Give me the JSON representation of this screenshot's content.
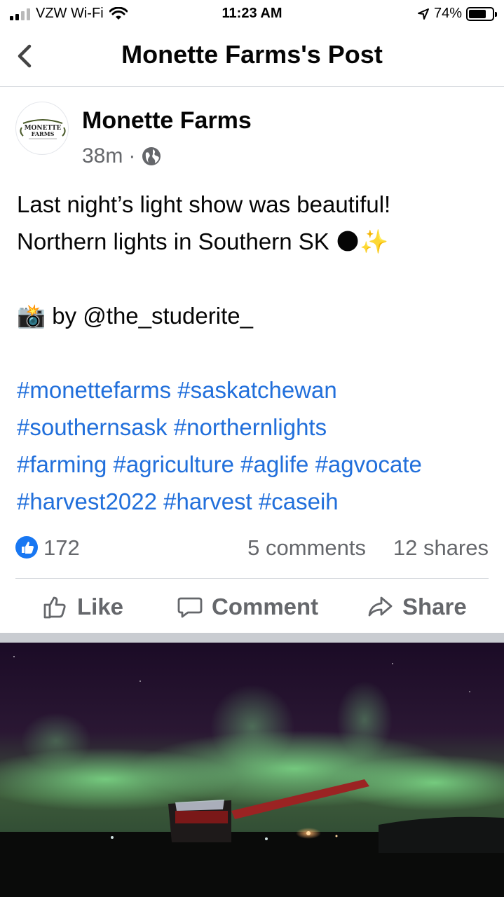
{
  "status_bar": {
    "carrier": "VZW Wi-Fi",
    "time": "11:23 AM",
    "battery": "74%",
    "battery_level": 0.74
  },
  "nav": {
    "title": "Monette Farms's Post",
    "back_icon": "chevron-left-icon"
  },
  "post": {
    "page_name": "Monette Farms",
    "avatar_text": "MONETTE FARMS",
    "time_ago": "38m",
    "separator": "·",
    "privacy_icon": "globe-icon",
    "lines": [
      "Last night’s light show was beautiful!",
      "Northern lights in Southern SK"
    ],
    "emoji_line2": "🌑✨",
    "credit_emoji": "📸",
    "credit_text": "by @the_studerite_",
    "hashtag_lines": [
      "#monettefarms #saskatchewan",
      "#southernsask #northernlights",
      "#farming #agriculture #aglife #agvocate",
      "#harvest2022 #harvest #caseih"
    ]
  },
  "counts": {
    "reactions": "172",
    "comments": "5 comments",
    "shares": "12 shares"
  },
  "actions": {
    "like": "Like",
    "comment": "Comment",
    "share": "Share"
  },
  "colors": {
    "link": "#216fdb",
    "like_blue": "#1877f2",
    "secondary_text": "#65676b"
  }
}
